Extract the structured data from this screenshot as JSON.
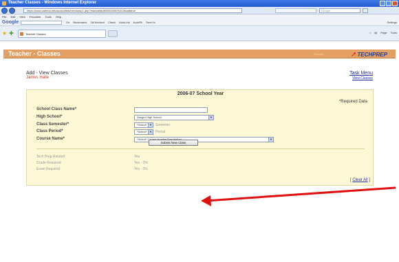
{
  "window": {
    "title": "Teacher Classes - Windows Internet Explorer"
  },
  "browser": {
    "url": "https://www.catema.net/accs/cl/teacher/class/1.php?markdefault00000000%2Chbadbtrue",
    "search_placeholder": "Google",
    "menu": [
      "File",
      "Edit",
      "View",
      "Favorites",
      "Tools",
      "Help"
    ],
    "google_toolbar": {
      "logo": "Google",
      "items": [
        "Go",
        "Bookmarks",
        "1M blocked",
        "Check",
        "AutoLink",
        "AutoFill",
        "Send to"
      ],
      "settings": "Settings"
    },
    "tab_title": "Teacher Classes",
    "command_bar": [
      "Page",
      "Tools"
    ]
  },
  "app": {
    "title": "Teacher - Classes",
    "subtitle": "Security",
    "logo_text": "TECHPREP"
  },
  "page": {
    "section_title": "Add - View Classes",
    "person": "James Halle",
    "task_menu": "Task Menu",
    "view_classes": "View Classes",
    "year_title": "2006-07 School Year",
    "required_note": "*Required Data",
    "labels": {
      "school_class_name": "School Class Name*",
      "high_school": "High School*",
      "class_semester": "Class Semester*",
      "class_period": "Class Period*",
      "course_name": "Course Name*"
    },
    "values": {
      "school_class_name": "",
      "high_school": "Sanger High School",
      "class_semester": "*Select*",
      "class_semester_hint": "Semester",
      "class_period": "*Select*",
      "class_period_hint": "Period",
      "course_name": "*Select* Course Number/Description"
    },
    "info": [
      {
        "label": "Tech Prep Related",
        "value": "Yes"
      },
      {
        "label": "Grade Required",
        "value": "Yes - 0%"
      },
      {
        "label": "Exam Required",
        "value": "Yes - 0%"
      }
    ],
    "clear_all": "Clear All",
    "submit": "Submit New Class"
  },
  "colors": {
    "app_bar": "#e4a063",
    "panel": "#fdf8d6",
    "link": "#1f2fa0",
    "name_red": "#c0392b",
    "arrow": "#e01010"
  }
}
